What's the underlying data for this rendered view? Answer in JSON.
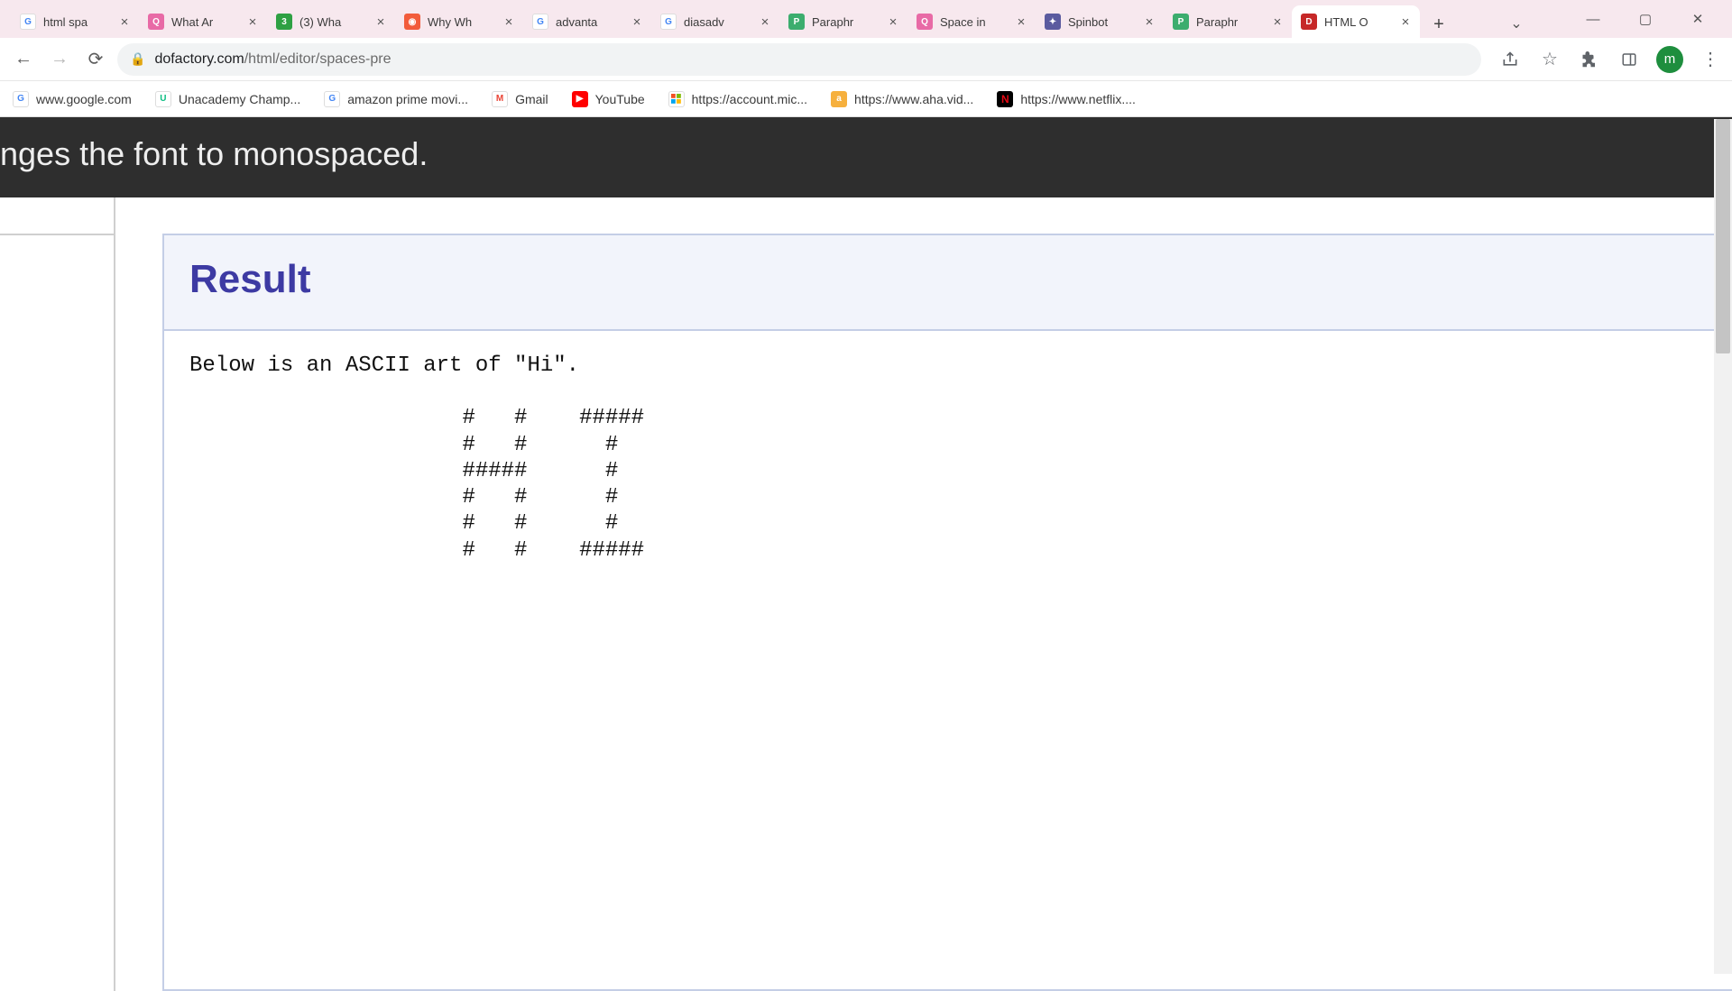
{
  "tabs": [
    {
      "label": "html spa"
    },
    {
      "label": "What Ar"
    },
    {
      "label": "(3) Wha"
    },
    {
      "label": "Why Wh"
    },
    {
      "label": "advanta"
    },
    {
      "label": "diasadv"
    },
    {
      "label": "Paraphr"
    },
    {
      "label": "Space in"
    },
    {
      "label": "Spinbot"
    },
    {
      "label": "Paraphr"
    },
    {
      "label": "HTML O"
    }
  ],
  "url": {
    "authority": "dofactory.com",
    "path": "/html/editor/spaces-pre"
  },
  "avatar_initial": "m",
  "bookmarks": [
    {
      "label": "www.google.com"
    },
    {
      "label": "Unacademy Champ..."
    },
    {
      "label": "amazon prime movi..."
    },
    {
      "label": "Gmail"
    },
    {
      "label": "YouTube"
    },
    {
      "label": "https://account.mic..."
    },
    {
      "label": "https://www.aha.vid..."
    },
    {
      "label": "https://www.netflix...."
    }
  ],
  "dark_strip_text": "nges the font to monospaced.",
  "result": {
    "title": "Result",
    "pre": "Below is an ASCII art of \"Hi\".\n\n                     #   #    #####\n                     #   #      #\n                     #####      #\n                     #   #      #\n                     #   #      #\n                     #   #    #####"
  }
}
